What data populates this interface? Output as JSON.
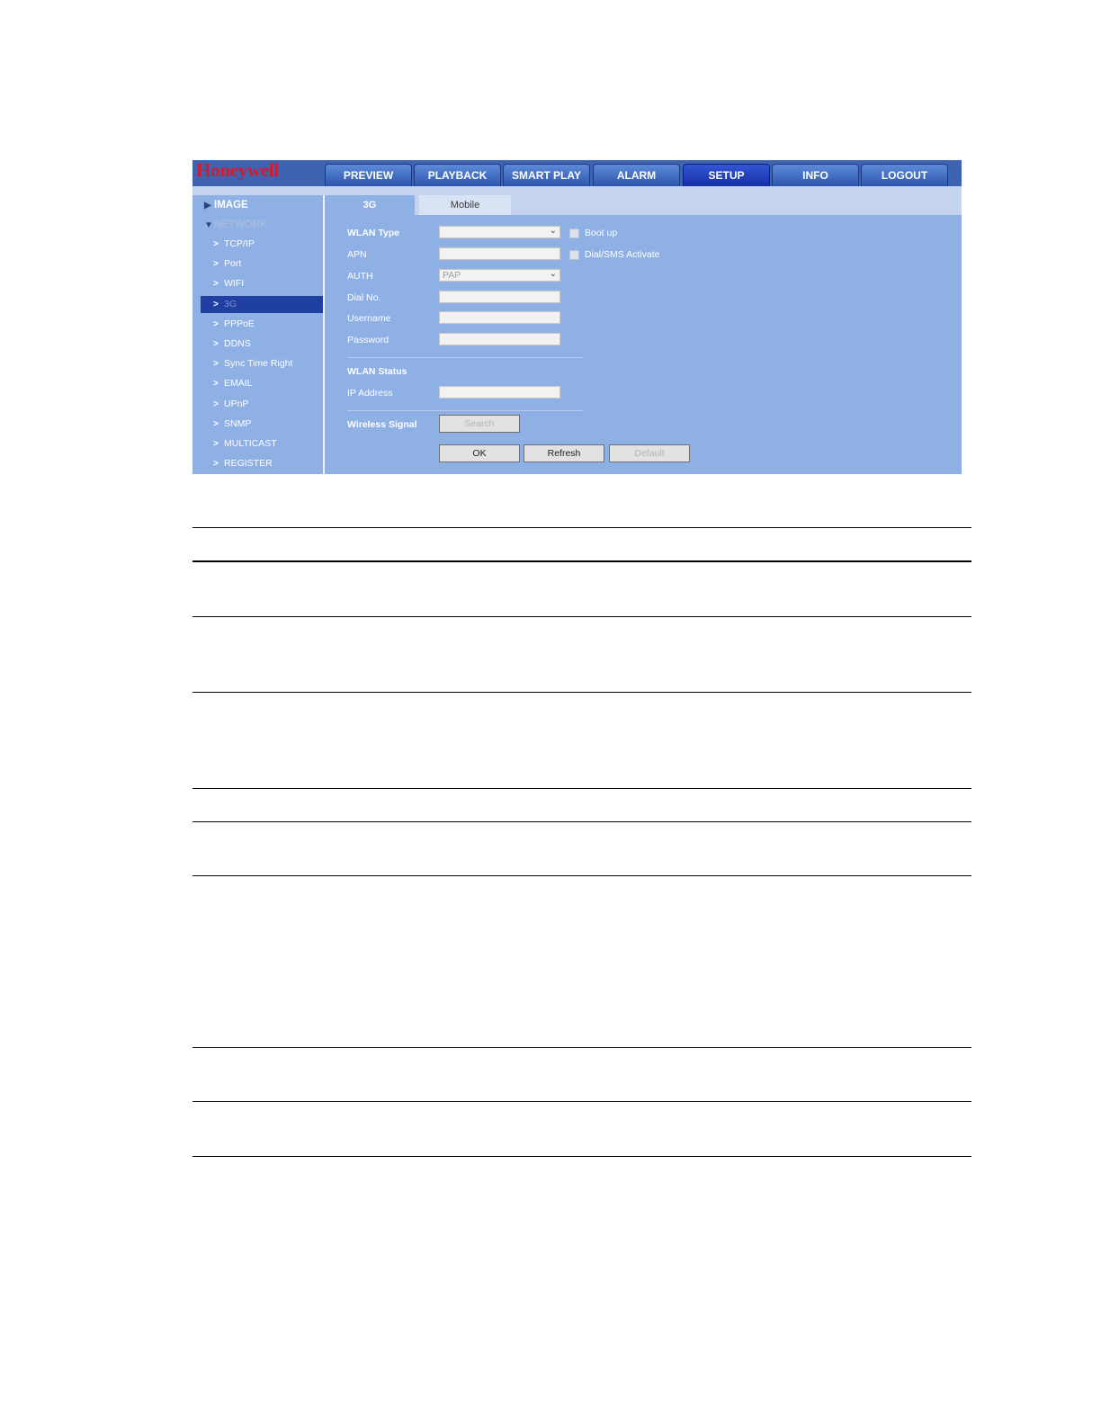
{
  "app": {
    "logo": "Honeywell"
  },
  "nav": {
    "tabs": [
      "PREVIEW",
      "PLAYBACK",
      "SMART PLAY",
      "ALARM",
      "SETUP",
      "INFO",
      "LOGOUT"
    ],
    "active": "SETUP"
  },
  "sidebar": {
    "image_label": "IMAGE",
    "network_label": "NETWORK",
    "items": [
      "TCP/IP",
      "Port",
      "WIFI",
      "3G",
      "PPPoE",
      "DDNS",
      "Sync Time Right",
      "EMAIL",
      "UPnP",
      "SNMP",
      "MULTICAST",
      "REGISTER"
    ],
    "active": "3G"
  },
  "subtabs": {
    "active": "3G",
    "other": "Mobile"
  },
  "form": {
    "wlan_type_label": "WLAN Type",
    "wlan_type_value": "",
    "boot_up_label": "Boot up",
    "apn_label": "APN",
    "apn_value": "",
    "dial_sms_label": "Dial/SMS Activate",
    "auth_label": "AUTH",
    "auth_value": "PAP",
    "dial_no_label": "Dial No.",
    "dial_no_value": "",
    "username_label": "Username",
    "username_value": "",
    "password_label": "Password",
    "password_value": "",
    "wlan_status_label": "WLAN Status",
    "ip_address_label": "IP Address",
    "ip_address_value": "",
    "wireless_signal_label": "Wireless Signal",
    "search_label": "Search",
    "ok_label": "OK",
    "refresh_label": "Refresh",
    "default_label": "Default"
  },
  "colors": {
    "brand_red": "#d8192a",
    "header_blue": "#3e63b0",
    "panel_blue": "#8eb0e4",
    "active_blue": "#1f3fa2"
  }
}
